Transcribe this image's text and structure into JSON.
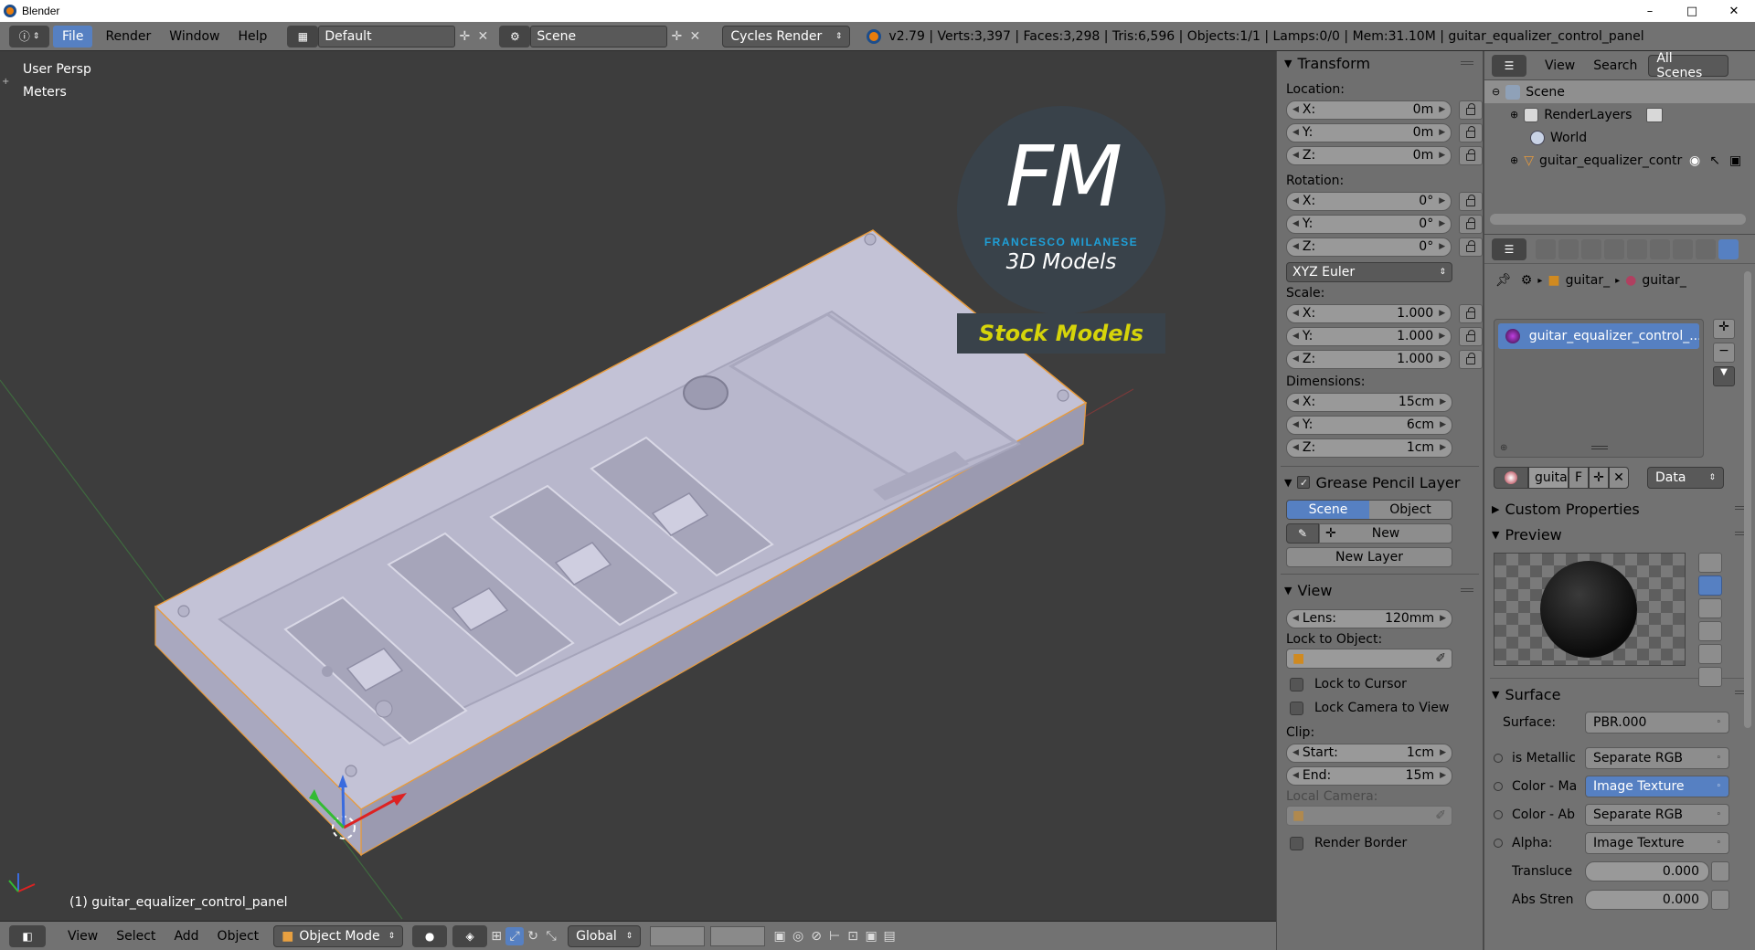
{
  "window": {
    "title": "Blender",
    "minimize": "–",
    "maximize": "□",
    "close": "✕"
  },
  "info_header": {
    "menus": [
      "File",
      "Render",
      "Window",
      "Help"
    ],
    "screen_layout": "Default",
    "scene": "Scene",
    "engine": "Cycles Render",
    "stats": "v2.79 | Verts:3,397 | Faces:3,298 | Tris:6,596 | Objects:1/1 | Lamps:0/0 | Mem:31.10M | guitar_equalizer_control_panel"
  },
  "viewport": {
    "view_name": "User Persp",
    "units": "Meters",
    "object_label": "(1) guitar_equalizer_control_panel",
    "watermark": {
      "initials": "FM",
      "author": "FRANCESCO MILANESE",
      "tagline": "3D Models",
      "banner": "Stock Models"
    },
    "colors": {
      "background": "#3d3d3d",
      "model": "#c8c7da",
      "selection": "#e89b3c",
      "brand": "#1fa0d8",
      "banner_text": "#d6d40a"
    }
  },
  "viewport_toolbar": {
    "menus": [
      "View",
      "Select",
      "Add",
      "Object"
    ],
    "mode": "Object Mode",
    "orientation": "Global"
  },
  "transform": {
    "title": "Transform",
    "location_label": "Location:",
    "location": [
      {
        "axis": "X:",
        "value": "0m"
      },
      {
        "axis": "Y:",
        "value": "0m"
      },
      {
        "axis": "Z:",
        "value": "0m"
      }
    ],
    "rotation_label": "Rotation:",
    "rotation": [
      {
        "axis": "X:",
        "value": "0°"
      },
      {
        "axis": "Y:",
        "value": "0°"
      },
      {
        "axis": "Z:",
        "value": "0°"
      }
    ],
    "rotation_mode": "XYZ Euler",
    "scale_label": "Scale:",
    "scale": [
      {
        "axis": "X:",
        "value": "1.000"
      },
      {
        "axis": "Y:",
        "value": "1.000"
      },
      {
        "axis": "Z:",
        "value": "1.000"
      }
    ],
    "dimensions_label": "Dimensions:",
    "dimensions": [
      {
        "axis": "X:",
        "value": "15cm"
      },
      {
        "axis": "Y:",
        "value": "6cm"
      },
      {
        "axis": "Z:",
        "value": "1cm"
      }
    ]
  },
  "grease_pencil": {
    "title": "Grease Pencil Layer",
    "tabs": [
      "Scene",
      "Object"
    ],
    "new_label": "New",
    "new_layer_label": "New Layer"
  },
  "view_panel": {
    "title": "View",
    "lens_label": "Lens:",
    "lens_value": "120mm",
    "lock_object_label": "Lock to Object:",
    "lock_cursor": "Lock to Cursor",
    "lock_camera": "Lock Camera to View",
    "clip_label": "Clip:",
    "clip_start_label": "Start:",
    "clip_start": "1cm",
    "clip_end_label": "End:",
    "clip_end": "15m",
    "local_camera_label": "Local Camera:",
    "render_border": "Render Border"
  },
  "outliner": {
    "menus": [
      "View",
      "Search"
    ],
    "filter": "All Scenes",
    "items": [
      {
        "label": "Scene"
      },
      {
        "label": "RenderLayers"
      },
      {
        "label": "World"
      },
      {
        "label": "guitar_equalizer_contr"
      }
    ]
  },
  "properties": {
    "breadcrumb": [
      "guitar_",
      "guitar_"
    ],
    "material_slot": "guitar_equalizer_control_...",
    "material_name": "guitar",
    "fake_user": "F",
    "link_mode": "Data",
    "custom_properties": "Custom Properties",
    "preview": "Preview",
    "surface_title": "Surface",
    "surface_label": "Surface:",
    "surface_value": "PBR.000",
    "inputs": [
      {
        "label": "is Metallic",
        "value": "Separate RGB",
        "active": false
      },
      {
        "label": "Color - Ma",
        "value": "Image Texture",
        "active": true
      },
      {
        "label": "Color - Ab",
        "value": "Separate RGB",
        "active": false
      },
      {
        "label": "Alpha:",
        "value": "Image Texture",
        "active": false
      }
    ],
    "sliders": [
      {
        "label": "Transluce",
        "value": "0.000"
      },
      {
        "label": "Abs Stren",
        "value": "0.000"
      }
    ]
  }
}
